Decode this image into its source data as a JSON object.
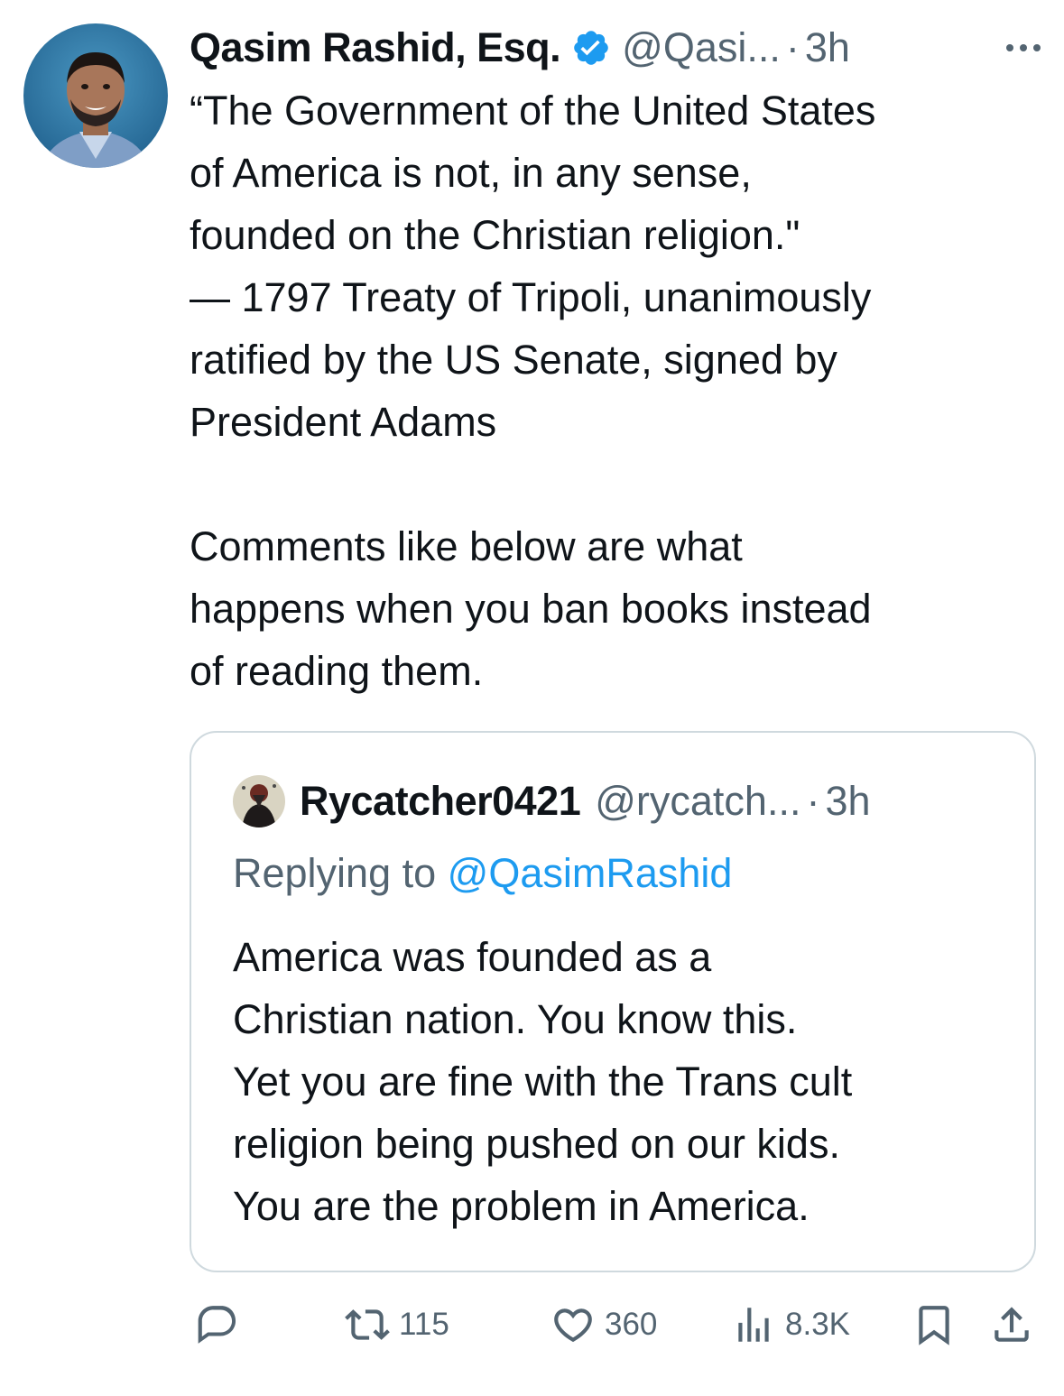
{
  "author": {
    "display_name": "Qasim Rashid, Esq.",
    "handle": "@Qasi...",
    "separator": "·",
    "time": "3h",
    "verified": true,
    "verified_color": "#1d9bf0"
  },
  "tweet": {
    "text": "“The Government of the United States\nof America is not, in any sense,\nfounded on the Christian religion.\"\n— 1797 Treaty of Tripoli, unanimously\nratified by the US Senate, signed by\nPresident Adams\n\nComments like below are what\nhappens when you ban books instead\nof reading them."
  },
  "quote": {
    "display_name": "Rycatcher0421",
    "handle": "@rycatch...",
    "separator": "·",
    "time": "3h",
    "replying_prefix": "Replying to ",
    "replying_to": "@QasimRashid",
    "text": "America was founded as a\nChristian nation. You know this.\nYet you are fine with the Trans cult\nreligion being pushed on our kids.\nYou are the problem in America."
  },
  "actions": {
    "reply_icon": "reply-icon",
    "retweets": "115",
    "likes": "360",
    "views": "8.3K",
    "bookmark_icon": "bookmark-icon",
    "share_icon": "share-icon"
  },
  "colors": {
    "text": "#0f1419",
    "secondary": "#536471",
    "accent": "#1d9bf0",
    "border": "#cfd9de"
  }
}
